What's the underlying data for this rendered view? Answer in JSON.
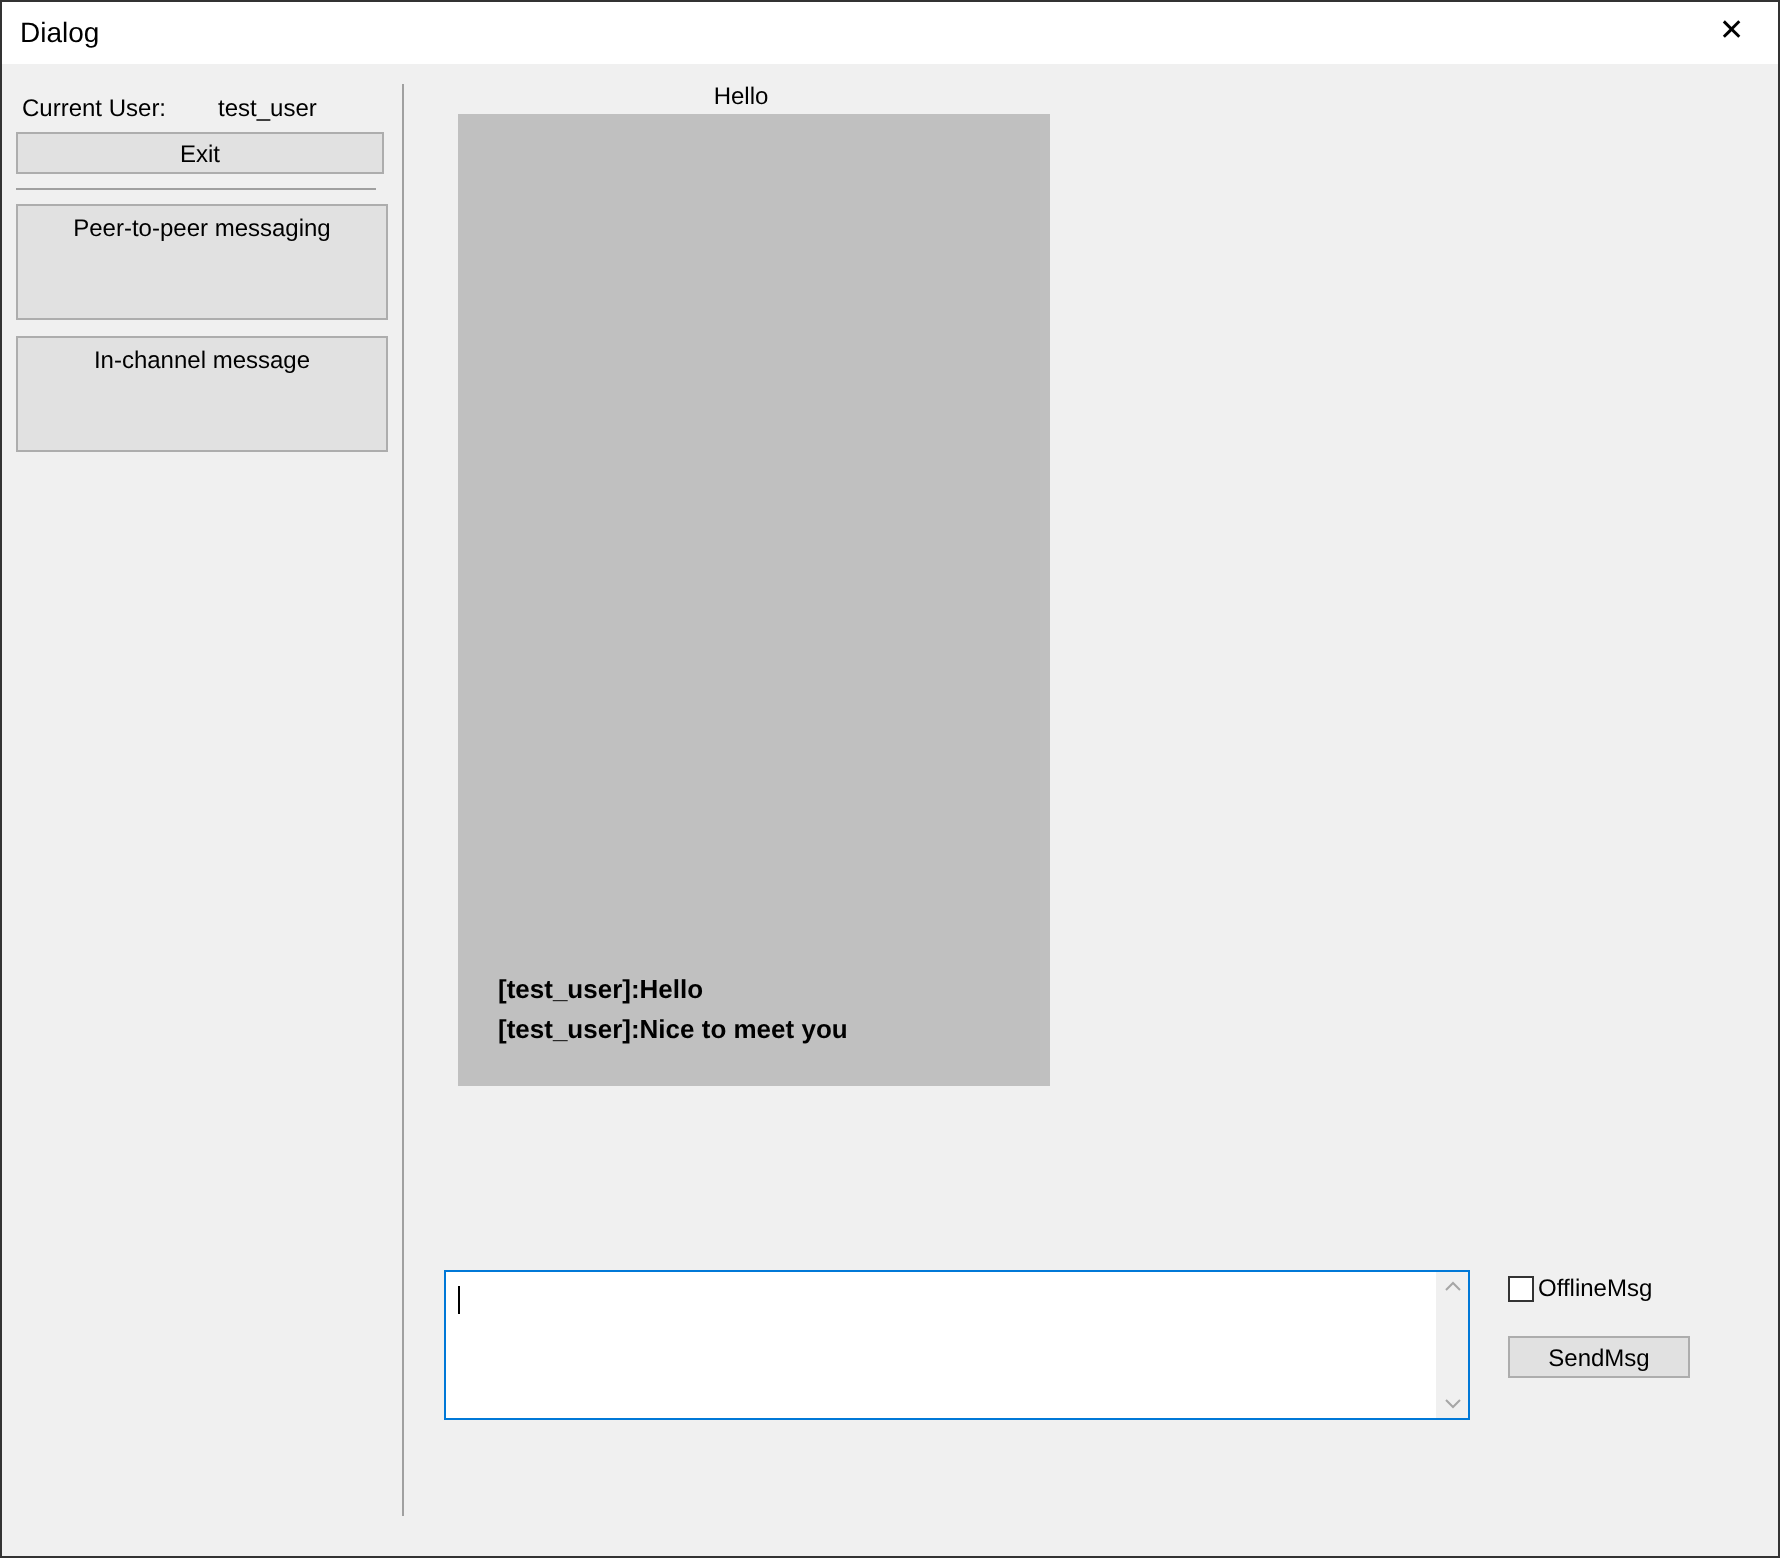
{
  "window": {
    "title": "Dialog",
    "close": "✕"
  },
  "sidebar": {
    "user_label": "Current User:",
    "user_name": "test_user",
    "exit_button": "Exit",
    "buttons": [
      {
        "label": "Peer-to-peer messaging"
      },
      {
        "label": "In-channel message"
      }
    ]
  },
  "chat": {
    "title": "Hello",
    "messages": [
      "[test_user]:Hello",
      "[test_user]:Nice to meet you"
    ]
  },
  "compose": {
    "focused": true,
    "offline": {
      "label": "OfflineMsg",
      "checked": false
    },
    "send_button": "SendMsg"
  }
}
